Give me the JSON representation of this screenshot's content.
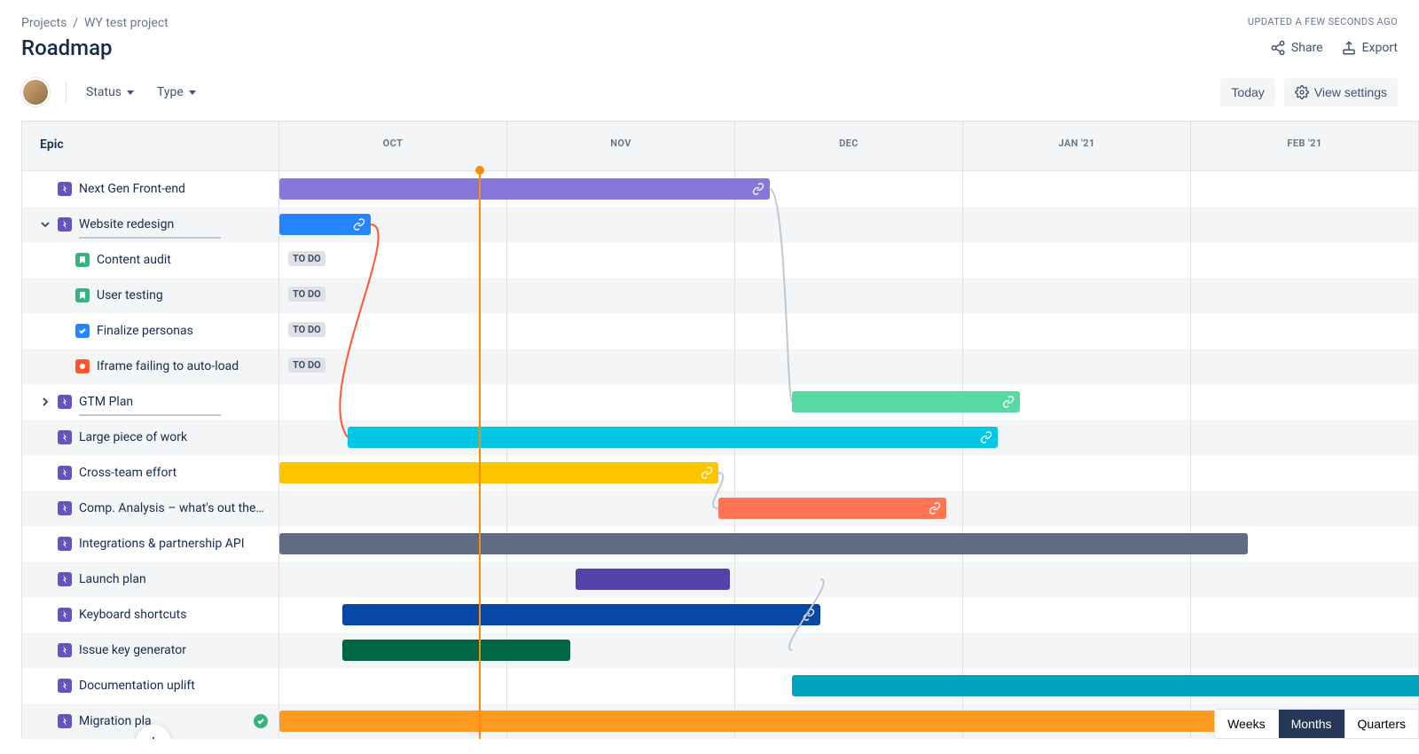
{
  "breadcrumb": {
    "root": "Projects",
    "project": "WY test project"
  },
  "page": {
    "title": "Roadmap",
    "updated_text": "UPDATED A FEW SECONDS AGO"
  },
  "actions": {
    "share": "Share",
    "export": "Export"
  },
  "filters": {
    "status": "Status",
    "type": "Type"
  },
  "toolbar": {
    "today": "Today",
    "view_settings": "View settings"
  },
  "columns": {
    "epic_header": "Epic"
  },
  "months": [
    "OCT",
    "NOV",
    "DEC",
    "JAN '21",
    "FEB '21"
  ],
  "scale": {
    "weeks": "Weeks",
    "months": "Months",
    "quarters": "Quarters",
    "active": "months"
  },
  "status_labels": {
    "to_do": "TO DO"
  },
  "epics": [
    {
      "id": "nextgen",
      "title": "Next Gen Front-end",
      "type": "epic",
      "bar": {
        "left_pct": 0,
        "width_pct": 43,
        "color": "#8777D9",
        "link": true
      }
    },
    {
      "id": "redesign",
      "title": "Website redesign",
      "type": "epic",
      "expanded": true,
      "has_progress": true,
      "bar": {
        "left_pct": 0,
        "width_pct": 8,
        "color": "#2684FF",
        "link": true
      },
      "children": [
        {
          "title": "Content audit",
          "type": "story",
          "status": "TO DO"
        },
        {
          "title": "User testing",
          "type": "story",
          "status": "TO DO"
        },
        {
          "title": "Finalize personas",
          "type": "task",
          "status": "TO DO"
        },
        {
          "title": "Iframe failing to auto-load",
          "type": "bug",
          "status": "TO DO"
        }
      ]
    },
    {
      "id": "gtm",
      "title": "GTM Plan",
      "type": "epic",
      "expanded": false,
      "has_progress": true,
      "bar": {
        "left_pct": 45,
        "width_pct": 20,
        "color": "#57D9A3",
        "link": true
      }
    },
    {
      "id": "large",
      "title": "Large piece of work",
      "type": "epic",
      "bar": {
        "left_pct": 6,
        "width_pct": 57,
        "color": "#00C7E6",
        "link": true
      }
    },
    {
      "id": "cross",
      "title": "Cross-team effort",
      "type": "epic",
      "bar": {
        "left_pct": 0,
        "width_pct": 38.5,
        "color": "#FFC400",
        "link": true
      }
    },
    {
      "id": "comp",
      "title": "Comp. Analysis – what's out there?",
      "type": "epic",
      "bar": {
        "left_pct": 38.5,
        "width_pct": 20,
        "color": "#FF7452",
        "link": true
      }
    },
    {
      "id": "integ",
      "title": "Integrations & partnership API",
      "type": "epic",
      "bar": {
        "left_pct": 0,
        "width_pct": 85,
        "color": "#5E6C84"
      }
    },
    {
      "id": "launch",
      "title": "Launch plan",
      "type": "epic",
      "bar": {
        "left_pct": 26,
        "width_pct": 13.5,
        "color": "#5243AA"
      }
    },
    {
      "id": "keyboard",
      "title": "Keyboard shortcuts",
      "type": "epic",
      "bar": {
        "left_pct": 5.5,
        "width_pct": 42,
        "color": "#0747A6",
        "link": true
      }
    },
    {
      "id": "issuekey",
      "title": "Issue key generator",
      "type": "epic",
      "bar": {
        "left_pct": 5.5,
        "width_pct": 20,
        "color": "#006644"
      }
    },
    {
      "id": "docs",
      "title": "Documentation uplift",
      "type": "epic",
      "bar": {
        "left_pct": 45,
        "width_pct": 60,
        "color": "#00A3BF"
      }
    },
    {
      "id": "migration",
      "title": "Migration pla",
      "type": "epic",
      "done": true,
      "bar": {
        "left_pct": 0,
        "width_pct": 105,
        "color": "#FF991F"
      }
    }
  ]
}
